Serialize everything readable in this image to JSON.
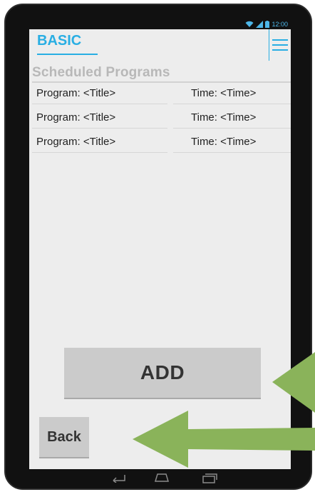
{
  "status_bar": {
    "time": "12:00"
  },
  "app_bar": {
    "title": "BASIC"
  },
  "section": {
    "title": "Scheduled Programs"
  },
  "programs": [
    {
      "program": "Program: <Title>",
      "time": "Time: <Time>"
    },
    {
      "program": "Program: <Title>",
      "time": "Time: <Time>"
    },
    {
      "program": "Program: <Title>",
      "time": "Time: <Time>"
    }
  ],
  "buttons": {
    "add": "ADD",
    "back": "Back"
  },
  "colors": {
    "accent": "#29aee3",
    "arrow": "#8ab35a",
    "screen_bg": "#ededed",
    "button_bg": "#cbcbcb"
  },
  "icons": [
    "wifi-icon",
    "signal-icon",
    "battery-icon",
    "menu-icon",
    "back-nav-icon",
    "home-nav-icon",
    "recents-nav-icon",
    "arrow-icon"
  ]
}
